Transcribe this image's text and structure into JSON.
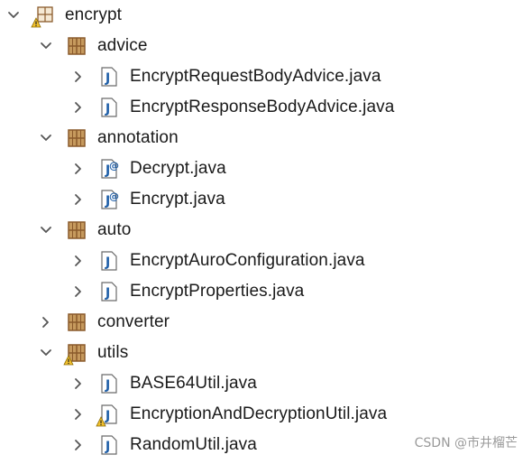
{
  "tree": {
    "nodes": [
      {
        "label": "encrypt",
        "type": "project",
        "expanded": true,
        "depth": 0,
        "warning": true
      },
      {
        "label": "advice",
        "type": "package",
        "expanded": true,
        "depth": 1
      },
      {
        "label": "EncryptRequestBodyAdvice.java",
        "type": "java",
        "expanded": false,
        "depth": 2
      },
      {
        "label": "EncryptResponseBodyAdvice.java",
        "type": "java",
        "expanded": false,
        "depth": 2
      },
      {
        "label": "annotation",
        "type": "package",
        "expanded": true,
        "depth": 1
      },
      {
        "label": "Decrypt.java",
        "type": "annotation-java",
        "expanded": false,
        "depth": 2
      },
      {
        "label": "Encrypt.java",
        "type": "annotation-java",
        "expanded": false,
        "depth": 2
      },
      {
        "label": "auto",
        "type": "package",
        "expanded": true,
        "depth": 1
      },
      {
        "label": "EncryptAuroConfiguration.java",
        "type": "java",
        "expanded": false,
        "depth": 2
      },
      {
        "label": "EncryptProperties.java",
        "type": "java",
        "expanded": false,
        "depth": 2
      },
      {
        "label": "converter",
        "type": "package",
        "expanded": false,
        "depth": 1
      },
      {
        "label": "utils",
        "type": "package",
        "expanded": true,
        "depth": 1,
        "warning": true
      },
      {
        "label": "BASE64Util.java",
        "type": "java",
        "expanded": false,
        "depth": 2
      },
      {
        "label": "EncryptionAndDecryptionUtil.java",
        "type": "java",
        "expanded": false,
        "depth": 2,
        "warning": true
      },
      {
        "label": "RandomUtil.java",
        "type": "java",
        "expanded": false,
        "depth": 2
      }
    ]
  },
  "watermark": "CSDN @市井榴芒",
  "colors": {
    "package_brown": "#8a5a2b",
    "package_fill": "#c69a5e",
    "java_blue": "#1f5fa8",
    "warning_yellow": "#f2c12e",
    "chevron": "#555555"
  },
  "icons": {
    "expanded": "chevron-down-icon",
    "collapsed": "chevron-right-icon",
    "project": "project-folder-icon",
    "package": "package-icon",
    "java": "java-file-icon",
    "annotation-java": "java-annotation-file-icon",
    "warning": "warning-icon"
  }
}
